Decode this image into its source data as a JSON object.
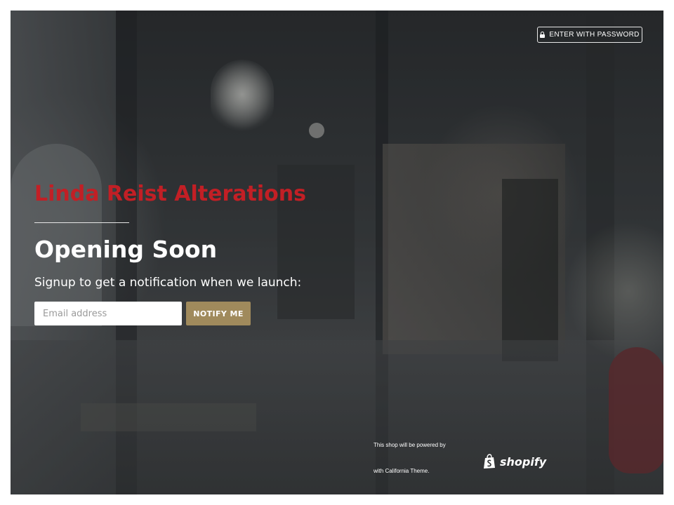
{
  "header": {
    "password_button_label": "ENTER WITH PASSWORD",
    "lock_icon": "lock-icon"
  },
  "main": {
    "shop_name": "Linda Reist Alterations",
    "headline": "Opening Soon",
    "subtext": "Signup to get a notification when we launch:",
    "email_placeholder": "Email address",
    "notify_label": "NOTIFY ME"
  },
  "footer": {
    "powered_line1": "This shop will be powered by",
    "powered_line2": "with California Theme.",
    "shopify_label": "shopify",
    "shopify_icon": "shopify-bag-icon"
  },
  "colors": {
    "brand_red": "#c21f25",
    "notify_button": "#a08a5c",
    "text": "#ffffff"
  }
}
